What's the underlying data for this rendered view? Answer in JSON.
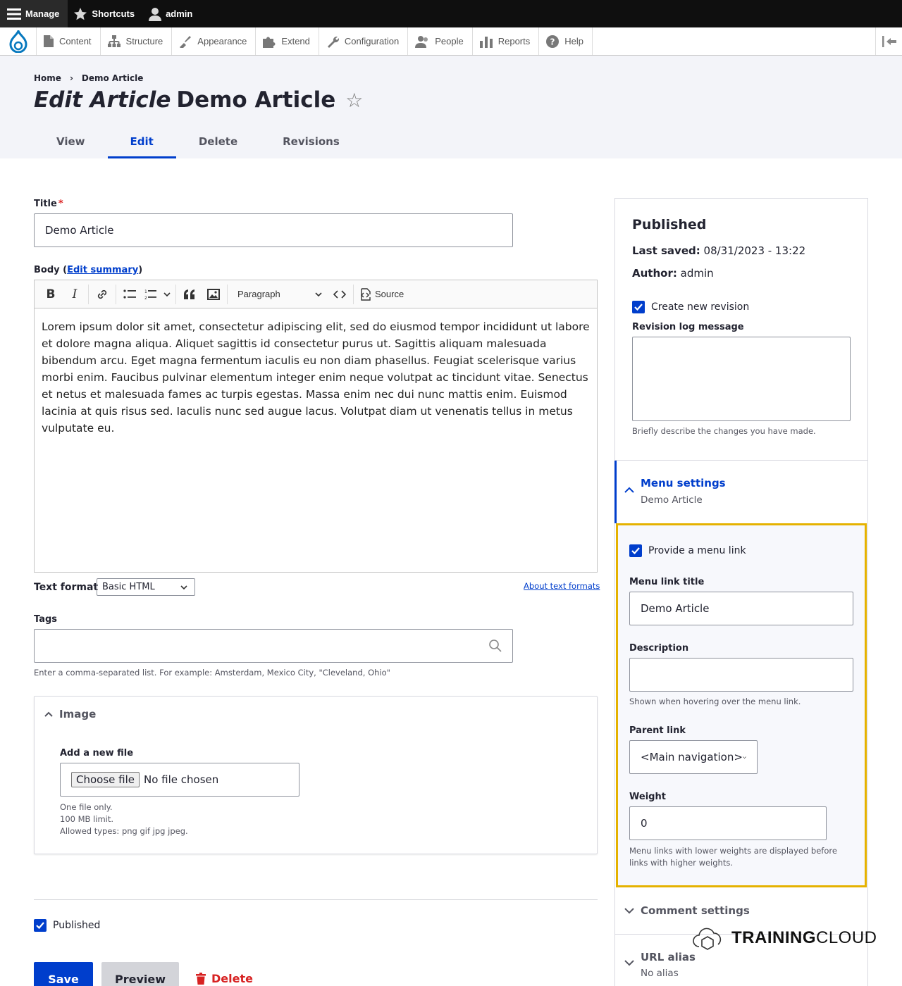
{
  "toolbar": {
    "manage": "Manage",
    "shortcuts": "Shortcuts",
    "user": "admin"
  },
  "admin_menu": {
    "items": [
      {
        "label": "Content",
        "icon": "document-icon"
      },
      {
        "label": "Structure",
        "icon": "structure-icon"
      },
      {
        "label": "Appearance",
        "icon": "brush-icon"
      },
      {
        "label": "Extend",
        "icon": "puzzle-icon"
      },
      {
        "label": "Configuration",
        "icon": "wrench-icon"
      },
      {
        "label": "People",
        "icon": "people-icon"
      },
      {
        "label": "Reports",
        "icon": "bar-chart-icon"
      },
      {
        "label": "Help",
        "icon": "help-icon"
      }
    ]
  },
  "breadcrumb": {
    "home": "Home",
    "current": "Demo Article"
  },
  "page": {
    "title_prefix": "Edit Article",
    "title": "Demo Article",
    "star": "☆"
  },
  "tabs": [
    {
      "label": "View",
      "active": false
    },
    {
      "label": "Edit",
      "active": true
    },
    {
      "label": "Delete",
      "active": false
    },
    {
      "label": "Revisions",
      "active": false
    }
  ],
  "form": {
    "title_label": "Title",
    "required_mark": "*",
    "title_value": "Demo Article",
    "body_label": "Body (",
    "body_link": "Edit summary",
    "body_label_end": ")",
    "editor": {
      "bold": "B",
      "italic": "I",
      "format": "Paragraph",
      "source": "Source",
      "text": "Lorem ipsum dolor sit amet, consectetur adipiscing elit, sed do eiusmod tempor incididunt ut labore et dolore magna aliqua. Aliquet sagittis id consectetur purus ut. Sagittis aliquam malesuada bibendum arcu. Eget magna fermentum iaculis eu non diam phasellus. Feugiat scelerisque varius morbi enim. Faucibus pulvinar elementum integer enim neque volutpat ac tincidunt vitae. Senectus et netus et malesuada fames ac turpis egestas. Massa enim nec dui nunc mattis enim. Euismod lacinia at quis risus sed. Iaculis nunc sed augue lacus. Volutpat diam ut venenatis tellus in metus vulputate eu."
    },
    "text_format_label": "Text format",
    "text_format_value": "Basic HTML",
    "about_formats": "About text formats",
    "tags_label": "Tags",
    "tags_value": "",
    "tags_desc": "Enter a comma-separated list. For example: Amsterdam, Mexico City, \"Cleveland, Ohio\"",
    "image": {
      "title": "Image",
      "add_label": "Add a new file",
      "choose": "Choose file",
      "no_file": "No file chosen",
      "desc1": "One file only.",
      "desc2": "100 MB limit.",
      "desc3": "Allowed types: png gif jpg jpeg."
    },
    "published_label": "Published"
  },
  "actions": {
    "save": "Save",
    "preview": "Preview",
    "delete": "Delete"
  },
  "sidebar": {
    "status": "Published",
    "last_saved_label": "Last saved:",
    "last_saved_value": "08/31/2023 - 13:22",
    "author_label": "Author:",
    "author_value": "admin",
    "create_revision": "Create new revision",
    "revision_log_label": "Revision log message",
    "revision_log_value": "",
    "revision_desc": "Briefly describe the changes you have made.",
    "menu_settings": {
      "title": "Menu settings",
      "summary": "Demo Article",
      "provide_link": "Provide a menu link",
      "link_title_label": "Menu link title",
      "link_title_value": "Demo Article",
      "description_label": "Description",
      "description_value": "",
      "description_desc": "Shown when hovering over the menu link.",
      "parent_label": "Parent link",
      "parent_value": "<Main navigation>",
      "weight_label": "Weight",
      "weight_value": "0",
      "weight_desc": "Menu links with lower weights are displayed before links with higher weights."
    },
    "comment_settings": "Comment settings",
    "url_alias": {
      "title": "URL alias",
      "summary": "No alias"
    }
  },
  "watermark": {
    "text_a": "TRAINING",
    "text_b": "CLOUD"
  },
  "colors": {
    "accent": "#003ecc",
    "highlight": "#e5b200",
    "delete": "#d72222"
  }
}
